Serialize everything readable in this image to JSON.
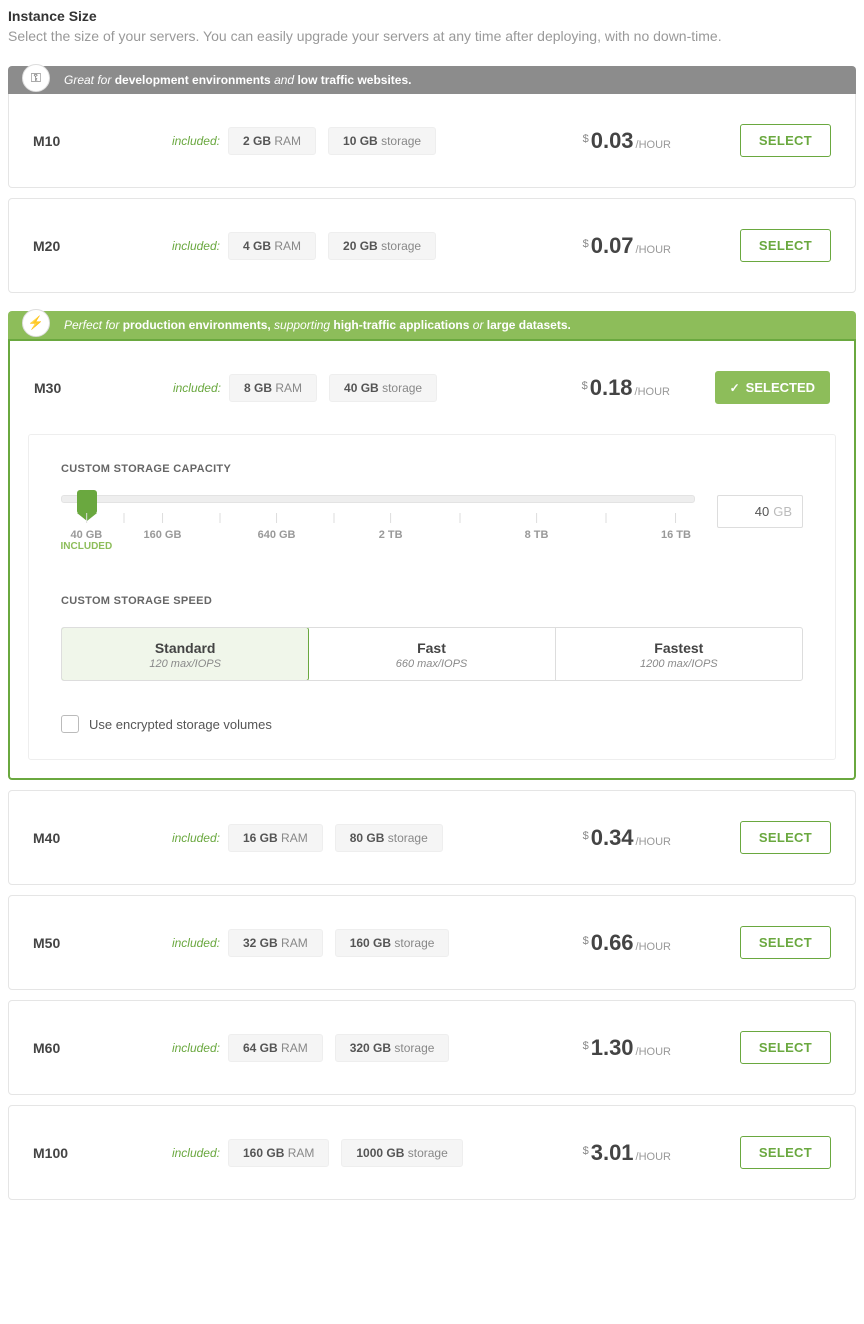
{
  "header": {
    "title": "Instance Size",
    "subtitle": "Select the size of your servers. You can easily upgrade your servers at any time after deploying, with no down-time."
  },
  "banners": {
    "dev": {
      "prefix": "Great for ",
      "bold1": "development environments",
      "mid": " and ",
      "bold2": "low traffic websites."
    },
    "prod": {
      "prefix": "Perfect for ",
      "bold1": "production environments,",
      "mid": " supporting ",
      "bold2": "high-traffic applications",
      "mid2": " or ",
      "bold3": "large datasets."
    }
  },
  "labels": {
    "included": "included:",
    "ram_suffix": "RAM",
    "storage_suffix": "storage",
    "per_hour": "/HOUR",
    "dollar": "$",
    "select": "SELECT",
    "selected": "SELECTED"
  },
  "tiers": {
    "m10": {
      "name": "M10",
      "ram": "2 GB",
      "storage": "10 GB",
      "price": "0.03"
    },
    "m20": {
      "name": "M20",
      "ram": "4 GB",
      "storage": "20 GB",
      "price": "0.07"
    },
    "m30": {
      "name": "M30",
      "ram": "8 GB",
      "storage": "40 GB",
      "price": "0.18"
    },
    "m40": {
      "name": "M40",
      "ram": "16 GB",
      "storage": "80 GB",
      "price": "0.34"
    },
    "m50": {
      "name": "M50",
      "ram": "32 GB",
      "storage": "160 GB",
      "price": "0.66"
    },
    "m60": {
      "name": "M60",
      "ram": "64 GB",
      "storage": "320 GB",
      "price": "1.30"
    },
    "m100": {
      "name": "M100",
      "ram": "160 GB",
      "storage": "1000 GB",
      "price": "3.01"
    }
  },
  "detail": {
    "storage_capacity_label": "CUSTOM STORAGE CAPACITY",
    "storage_speed_label": "CUSTOM STORAGE SPEED",
    "slider_value": "40",
    "slider_unit": "GB",
    "ticks": {
      "t0": {
        "label": "40 GB",
        "sub": "INCLUDED"
      },
      "t1": {
        "label": "160 GB"
      },
      "t2": {
        "label": "640 GB"
      },
      "t3": {
        "label": "2 TB"
      },
      "t4": {
        "label": "8 TB"
      },
      "t5": {
        "label": "16 TB"
      }
    },
    "speeds": {
      "standard": {
        "name": "Standard",
        "sub": "120 max/IOPS"
      },
      "fast": {
        "name": "Fast",
        "sub": "660 max/IOPS"
      },
      "fastest": {
        "name": "Fastest",
        "sub": "1200 max/IOPS"
      }
    },
    "encrypt_label": "Use encrypted storage volumes"
  }
}
